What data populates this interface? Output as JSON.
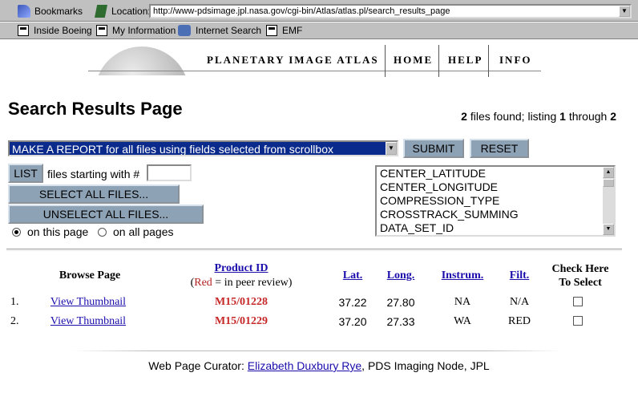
{
  "browser": {
    "bookmarks_label": "Bookmarks",
    "location_label": "Location:",
    "url": "http://www-pdsimage.jpl.nasa.gov/cgi-bin/Atlas/atlas.pl/search_results_page",
    "personal_links": [
      "Inside Boeing",
      "My Information",
      "Internet Search",
      "EMF"
    ]
  },
  "header": {
    "atlas_title": "PLANETARY IMAGE ATLAS",
    "nav": [
      "HOME",
      "HELP",
      "INFO"
    ]
  },
  "page": {
    "title": "Search Results Page",
    "found_count": "2",
    "found_text": " files found; listing ",
    "from": "1",
    "through_text": " through ",
    "to": "2"
  },
  "form": {
    "action_select": "MAKE A REPORT for all files using fields selected from scrollbox",
    "submit_label": "SUBMIT",
    "reset_label": "RESET",
    "list_label": "LIST",
    "files_starting_text": "files starting with #",
    "select_all_label": "SELECT ALL FILES...",
    "unselect_all_label": "UNSELECT ALL FILES...",
    "radio_this_page": "on this page",
    "radio_all_pages": "on all pages",
    "fields": [
      "CENTER_LATITUDE",
      "CENTER_LONGITUDE",
      "COMPRESSION_TYPE",
      "CROSSTRACK_SUMMING",
      "DATA_SET_ID"
    ]
  },
  "table": {
    "headers": {
      "browse": "Browse Page",
      "product_id": "Product ID",
      "peer_open": "(",
      "peer_red": "Red",
      "peer_rest": " = in peer review)",
      "lat": "Lat.",
      "long": "Long.",
      "instrum": "Instrum.",
      "filt": "Filt.",
      "check_line1": "Check Here",
      "check_line2": "To Select"
    },
    "rows": [
      {
        "index": "1.",
        "browse": "View Thumbnail",
        "product_id": "M15/01228",
        "lat": "37.22",
        "long": "27.80",
        "instrum": "NA",
        "filt": "N/A"
      },
      {
        "index": "2.",
        "browse": "View Thumbnail",
        "product_id": "M15/01229",
        "lat": "37.20",
        "long": "27.33",
        "instrum": "WA",
        "filt": "RED"
      }
    ]
  },
  "footer": {
    "prefix": "Web Page Curator: ",
    "curator": "Elizabeth Duxbury Rye",
    "suffix": ", PDS Imaging Node, JPL"
  }
}
